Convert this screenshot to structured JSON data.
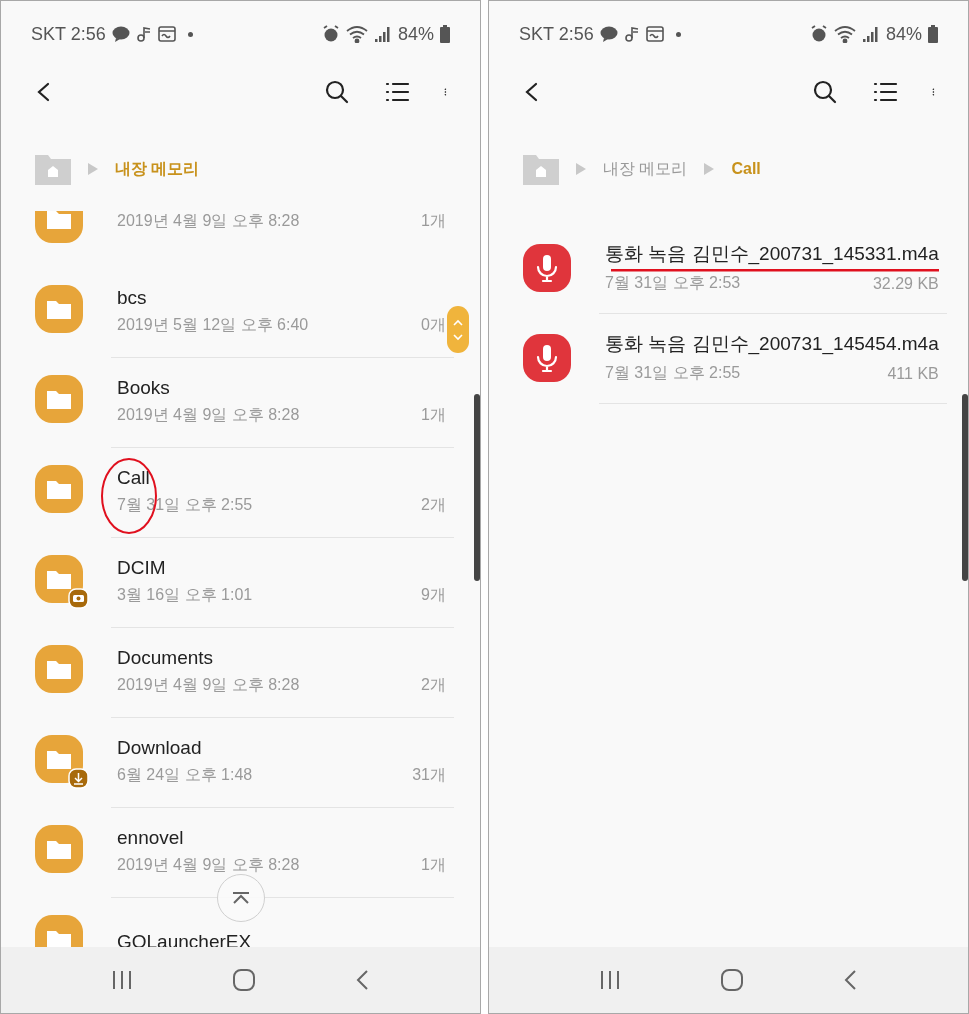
{
  "screens": [
    {
      "status_bar": {
        "carrier_time": "SKT 2:56",
        "battery": "84%"
      },
      "breadcrumb": [
        {
          "label": "내장 메모리",
          "current": true
        }
      ],
      "items": [
        {
          "kind": "folder_top_clipped",
          "date": "2019년 4월 9일 오후 8:28",
          "count": "1개"
        },
        {
          "kind": "folder",
          "name": "bcs",
          "date": "2019년 5월 12일 오후 6:40",
          "count": "0개"
        },
        {
          "kind": "folder",
          "name": "Books",
          "date": "2019년 4월 9일 오후 8:28",
          "count": "1개"
        },
        {
          "kind": "folder",
          "name": "Call",
          "date": "7월 31일 오후 2:55",
          "count": "2개",
          "circled": true
        },
        {
          "kind": "camera_folder",
          "name": "DCIM",
          "date": "3월 16일 오후 1:01",
          "count": "9개"
        },
        {
          "kind": "folder",
          "name": "Documents",
          "date": "2019년 4월 9일 오후 8:28",
          "count": "2개"
        },
        {
          "kind": "download_folder",
          "name": "Download",
          "date": "6월 24일 오후 1:48",
          "count": "31개"
        },
        {
          "kind": "folder",
          "name": "ennovel",
          "date": "2019년 4월 9일 오후 8:28",
          "count": "1개"
        },
        {
          "kind": "folder",
          "name": "GOLauncherEX"
        }
      ],
      "fast_scroll_handle": true,
      "scroll_top_button": true
    },
    {
      "status_bar": {
        "carrier_time": "SKT 2:56",
        "battery": "84%"
      },
      "breadcrumb": [
        {
          "label": "내장 메모리",
          "current": false
        },
        {
          "label": "Call",
          "current": true
        }
      ],
      "items": [
        {
          "kind": "recording",
          "name": "통화 녹음 김민수_200731_145331.m4a",
          "date": "7월 31일 오후 2:53",
          "count": "32.29 KB",
          "underlined": true
        },
        {
          "kind": "recording",
          "name": "통화 녹음 김민수_200731_145454.m4a",
          "date": "7월 31일 오후 2:55",
          "count": "411 KB"
        }
      ]
    }
  ]
}
